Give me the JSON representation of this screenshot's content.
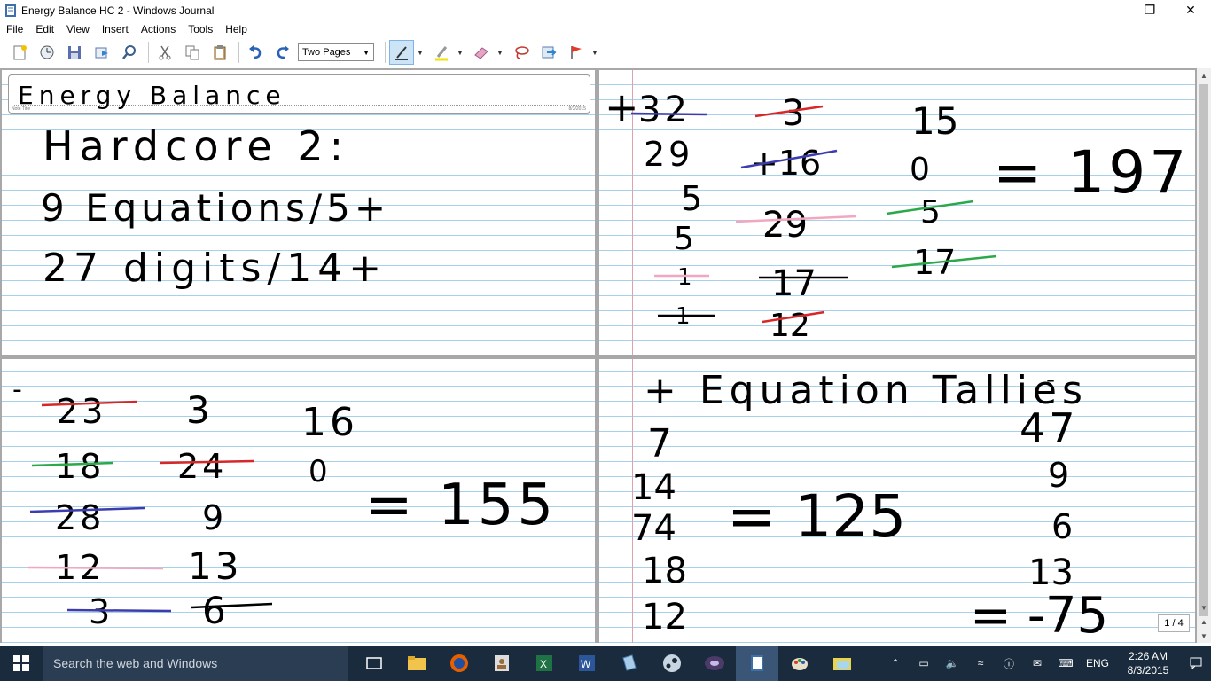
{
  "window": {
    "title": "Energy Balance HC 2 - Windows Journal"
  },
  "menu": [
    "File",
    "Edit",
    "View",
    "Insert",
    "Actions",
    "Tools",
    "Help"
  ],
  "toolbar": {
    "view_mode": "Two Pages",
    "buttons": [
      "new-note",
      "time-stamp",
      "save",
      "send-email",
      "find",
      "cut",
      "copy",
      "paste",
      "undo",
      "redo",
      "pen",
      "highlighter",
      "eraser",
      "lasso-select",
      "insert-space",
      "flag"
    ]
  },
  "note": {
    "title_label": "Note Title",
    "title_date": "8/3/2015",
    "handwriting": {
      "title": "Energy Balance",
      "line1": "Hardcore 2:",
      "line2": "9 Equations/5+",
      "line3": "27 digits/14+",
      "q2_header": "+",
      "q2_col1": [
        "32",
        "29",
        "5",
        "5",
        "1",
        "1"
      ],
      "q2_col2": [
        "3",
        "+16",
        "29",
        "17",
        "12"
      ],
      "q2_col3": [
        "15",
        "0",
        "5",
        "17"
      ],
      "q2_result": "= 197+",
      "q3_header": "-",
      "q3_col1": [
        "23",
        "18",
        "28",
        "12",
        "3"
      ],
      "q3_col2": [
        "3",
        "24",
        "9",
        "13",
        "6"
      ],
      "q3_col3": [
        "16",
        "0"
      ],
      "q3_result": "= 155",
      "q4_header": "+ Equation Tallies",
      "q4_col1": [
        "7",
        "14",
        "74",
        "18",
        "12"
      ],
      "q4_result1": "= 125",
      "q4_col2_header": "-",
      "q4_col2": [
        "47",
        "9",
        "6",
        "13"
      ],
      "q4_result2": "= -75"
    },
    "strike_colors": {
      "red": "#d62828",
      "blue": "#3c3caf",
      "green": "#2aa84a",
      "pink": "#f2a7c0",
      "black": "#000000"
    }
  },
  "page_indicator": "1 / 4",
  "taskbar": {
    "search_placeholder": "Search the web and Windows",
    "apps": [
      "task-view",
      "file-explorer",
      "firefox",
      "contacts",
      "excel",
      "word",
      "notepad",
      "steam",
      "media",
      "journal",
      "paint",
      "folder"
    ],
    "language": "ENG",
    "time": "2:26 AM",
    "date": "8/3/2015"
  }
}
